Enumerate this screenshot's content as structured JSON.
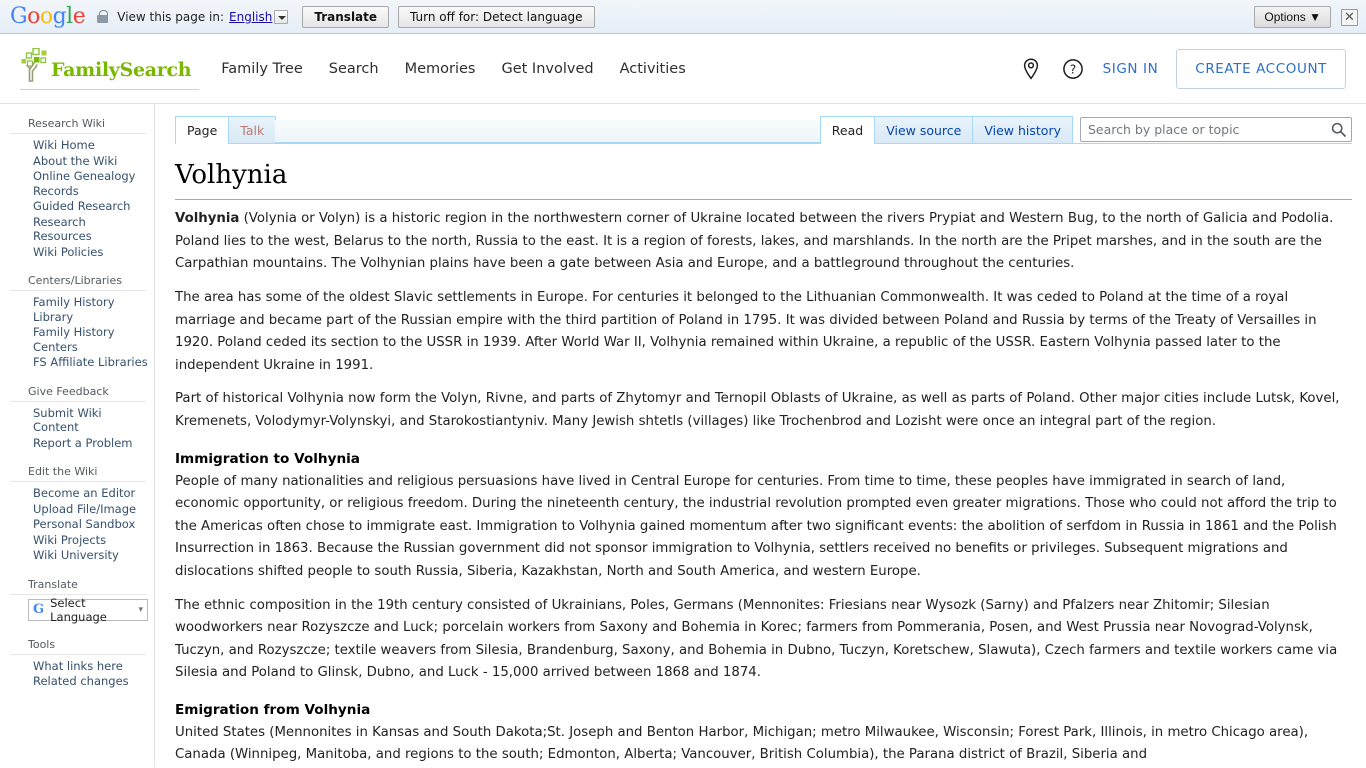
{
  "translate_bar": {
    "logo": "Google",
    "logo_letters": [
      "G",
      "o",
      "o",
      "g",
      "l",
      "e"
    ],
    "lock_icon": "lock-icon",
    "prompt": "View this page in:",
    "language": "English",
    "translate_button": "Translate",
    "turnoff_button": "Turn off for: Detect language",
    "options_button": "Options ▼",
    "close_label": "✕"
  },
  "header": {
    "brand": "FamilySearch",
    "nav": [
      {
        "label": "Family Tree"
      },
      {
        "label": "Search"
      },
      {
        "label": "Memories"
      },
      {
        "label": "Get Involved"
      },
      {
        "label": "Activities"
      }
    ],
    "location_icon": "map-pin-icon",
    "help_icon": "question-circle-icon",
    "sign_in": "SIGN IN",
    "create_account": "CREATE ACCOUNT"
  },
  "sidebar": {
    "groups": [
      {
        "heading": "Research Wiki",
        "items": [
          {
            "label": "Wiki Home"
          },
          {
            "label": "About the Wiki"
          },
          {
            "label": "Online Genealogy Records"
          },
          {
            "label": "Guided Research"
          },
          {
            "label": "Research Resources"
          },
          {
            "label": "Wiki Policies"
          }
        ]
      },
      {
        "heading": "Centers/Libraries",
        "items": [
          {
            "label": "Family History Library"
          },
          {
            "label": "Family History Centers"
          },
          {
            "label": "FS Affiliate Libraries"
          }
        ]
      },
      {
        "heading": "Give Feedback",
        "items": [
          {
            "label": "Submit Wiki Content"
          },
          {
            "label": "Report a Problem"
          }
        ]
      },
      {
        "heading": "Edit the Wiki",
        "items": [
          {
            "label": "Become an Editor"
          },
          {
            "label": "Upload File/Image"
          },
          {
            "label": "Personal Sandbox"
          },
          {
            "label": "Wiki Projects"
          },
          {
            "label": "Wiki University"
          }
        ]
      }
    ],
    "translate": {
      "heading": "Translate",
      "select_label": "Select Language",
      "google_mark": "G"
    },
    "tools": {
      "heading": "Tools",
      "items": [
        {
          "label": "What links here"
        },
        {
          "label": "Related changes"
        }
      ]
    }
  },
  "tabs": {
    "left": [
      {
        "label": "Page",
        "selected": true,
        "new": false
      },
      {
        "label": "Talk",
        "selected": false,
        "new": true
      }
    ],
    "right": [
      {
        "label": "Read",
        "selected": true
      },
      {
        "label": "View source",
        "selected": false
      },
      {
        "label": "View history",
        "selected": false
      }
    ]
  },
  "search": {
    "placeholder": "Search by place or topic",
    "value": "",
    "icon": "search-icon"
  },
  "article": {
    "title": "Volhynia",
    "paragraphs": [
      {
        "lead_bold": "Volhynia",
        "text": " (Volynia or Volyn) is a historic region in the northwestern corner of Ukraine located between the rivers Prypiat and Western Bug, to the north of Galicia and Podolia. Poland lies to the west, Belarus to the north, Russia to the east. It is a region of forests, lakes, and marshlands. In the north are the Pripet marshes, and in the south are the Carpathian mountains. The Volhynian plains have been a gate between Asia and Europe, and a battleground throughout the centuries."
      },
      {
        "text": "The area has some of the oldest Slavic settlements in Europe. For centuries it belonged to the Lithuanian Commonwealth. It was ceded to Poland at the time of a royal marriage and became part of the Russian empire with the third partition of Poland in 1795. It was divided between Poland and Russia by terms of the Treaty of Versailles in 1920. Poland ceded its section to the USSR in 1939. After World War II, Volhynia remained within Ukraine, a republic of the USSR. Eastern Volhynia passed later to the independent Ukraine in 1991."
      },
      {
        "text": "Part of historical Volhynia now form the Volyn, Rivne, and parts of Zhytomyr and Ternopil Oblasts of Ukraine, as well as parts of Poland. Other major cities include Lutsk, Kovel, Kremenets, Volodymyr-Volynskyi, and Starokostiantyniv. Many Jewish shtetls (villages) like Trochenbrod and Lozisht were once an integral part of the region."
      }
    ],
    "sections": [
      {
        "heading": "Immigration to Volhynia",
        "paragraphs": [
          "People of many nationalities and religious persuasions have lived in Central Europe for centuries. From time to time, these peoples have immigrated in search of land, economic opportunity, or religious freedom. During the nineteenth century, the industrial revolution prompted even greater migrations. Those who could not afford the trip to the Americas often chose to immigrate east. Immigration to Volhynia gained momentum after two significant events: the abolition of serfdom in Russia in 1861 and the Polish Insurrection in 1863. Because the Russian government did not sponsor immigration to Volhynia, settlers received no benefits or privileges. Subsequent migrations and dislocations shifted people to south Russia, Siberia, Kazakhstan, North and South America, and western Europe.",
          "The ethnic composition in the 19th century consisted of Ukrainians, Poles, Germans (Mennonites: Friesians near Wysozk (Sarny) and Pfalzers near Zhitomir; Silesian woodworkers near Rozyszcze and Luck; porcelain workers from Saxony and Bohemia in Korec; farmers from Pommerania, Posen, and West Prussia near Novograd-Volynsk, Tuczyn, and Rozyszcze; textile weavers from Silesia, Brandenburg, Saxony, and Bohemia in Dubno, Tuczyn, Koretschew, Slawuta), Czech farmers and textile workers came via Silesia and Poland to Glinsk, Dubno, and Luck - 15,000 arrived between 1868 and 1874."
        ]
      },
      {
        "heading": "Emigration from Volhynia",
        "paragraphs": [
          "United States (Mennonites in Kansas and South Dakota;St. Joseph and Benton Harbor, Michigan; metro Milwaukee, Wisconsin; Forest Park, Illinois, in metro Chicago area), Canada (Winnipeg, Manitoba, and regions to the south; Edmonton, Alberta; Vancouver, British Columbia), the Parana district of Brazil, Siberia and"
        ]
      }
    ]
  },
  "colors": {
    "brand_green": "#7ab800",
    "link_blue": "#2e6fc4",
    "wiki_link": "#36506d",
    "tab_border": "#a7d7f9",
    "newpage_red": "#ba7a73"
  }
}
